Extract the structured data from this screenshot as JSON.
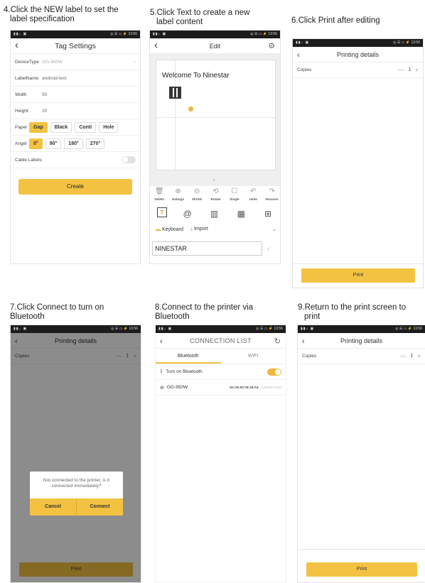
{
  "captions": [
    {
      "l1": "4.Click the NEW label to set the",
      "l2": "label specification"
    },
    {
      "l1": "5.Click Text to create a new",
      "l2": "label content"
    },
    {
      "l1": "6.Click Print after editing",
      "l2": ""
    },
    {
      "l1": "7.Click Connect to turn on",
      "l2": "Bluetooth"
    },
    {
      "l1": "8.Connect to the printer via",
      "l2": "Bluetooth"
    },
    {
      "l1": "9.Return to the print screen to",
      "l2": "print"
    }
  ],
  "status": {
    "left": "▮▮ᵢₗ ▣",
    "right": "◎ ☰ ▭ ⚡ 13:56"
  },
  "tag_settings": {
    "title": "Tag Settings",
    "device_label": "DeviceType",
    "device_value": "GG-950W",
    "labelname_label": "LabelName",
    "labelname_value": "android-test",
    "width_label": "Width",
    "width_value": "50",
    "height_label": "Height",
    "height_value": "20",
    "paper_label": "Paper",
    "paper_options": [
      "Gap",
      "Black",
      "Conti",
      "Hole"
    ],
    "angle_label": "Angel",
    "angle_options": [
      "0°",
      "90°",
      "180°",
      "270°"
    ],
    "cable_label": "Cable Labels",
    "create_label": "Create"
  },
  "edit": {
    "title": "Edit",
    "label_text": "Welcome To Ninestar",
    "tools": [
      "Delete",
      "Enlarge",
      "Shrink",
      "Rotate",
      "Single",
      "Undo",
      "Recover"
    ],
    "tool_icons": [
      "🗑",
      "⊕",
      "⊖",
      "⟲",
      "☐",
      "↶",
      "↷"
    ],
    "keyboard": "Keyboard",
    "import": "Import",
    "input_value": "NINESTAR",
    "element_text_icon": "T"
  },
  "printing": {
    "title": "Printing details",
    "copies_label": "Copies",
    "copies_value": "1",
    "print_label": "Print",
    "minus": "—",
    "plus": "+"
  },
  "dialog": {
    "message": "Not connected to the printer, is it connected immediately?",
    "cancel": "Cancel",
    "connect": "Connect"
  },
  "connection": {
    "title": "CONNECTION LIST",
    "tab_bluetooth": "Bluetooth",
    "tab_wifi": "WIFI",
    "turn_on": "Turn on Bluetooth",
    "device": "GG-950W",
    "mac": "DC:00:00:7E:18:A4",
    "state": "CONNECTED"
  },
  "colors": {
    "accent": "#f3c242"
  }
}
